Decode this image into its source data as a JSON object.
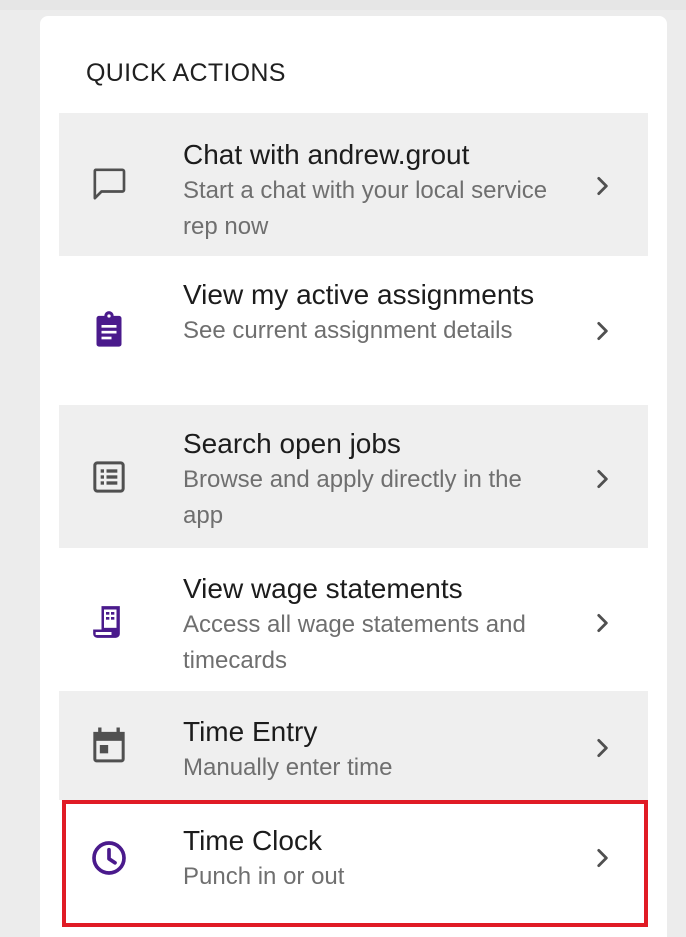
{
  "section": {
    "title": "QUICK ACTIONS"
  },
  "actions": [
    {
      "title": "Chat with andrew.grout",
      "subtitle": "Start a chat with your local service rep now",
      "icon": "chat-bubble-outline-icon"
    },
    {
      "title": "View my active assignments",
      "subtitle": "See current assignment details",
      "icon": "clipboard-assignment-icon"
    },
    {
      "title": "Search open jobs",
      "subtitle": "Browse and apply directly in the app",
      "icon": "list-box-icon"
    },
    {
      "title": "View wage statements",
      "subtitle": "Access all wage statements and timecards",
      "icon": "receipt-icon"
    },
    {
      "title": "Time Entry",
      "subtitle": "Manually enter time",
      "icon": "calendar-icon"
    },
    {
      "title": "Time Clock",
      "subtitle": "Punch in or out",
      "icon": "clock-icon"
    }
  ],
  "colors": {
    "accent_purple": "#4a1a8c",
    "icon_gray": "#505050",
    "row_shade": "#efefef",
    "highlight_red": "#e01b25"
  }
}
